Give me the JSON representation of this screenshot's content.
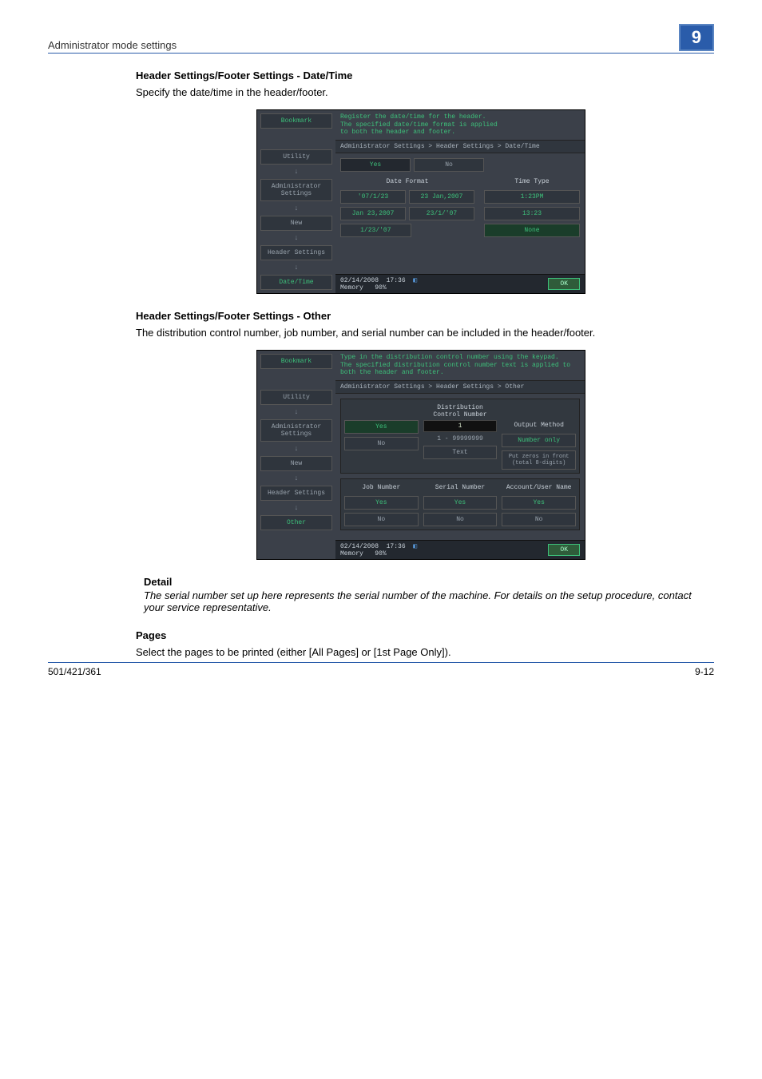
{
  "header": {
    "title": "Administrator mode settings",
    "chapter": "9"
  },
  "sections": {
    "datetime": {
      "title": "Header Settings/Footer Settings - Date/Time",
      "body": "Specify the date/time in the header/footer."
    },
    "other": {
      "title": "Header Settings/Footer Settings - Other",
      "body": "The distribution control number, job number, and serial number can be included in the header/footer."
    },
    "pages": {
      "title": "Pages",
      "body": "Select the pages to be printed (either [All Pages] or [1st Page Only])."
    }
  },
  "detail": {
    "label": "Detail",
    "body": "The serial number set up here represents the serial number of the machine. For details on the setup procedure, contact your service representative."
  },
  "footer": {
    "left": "501/421/361",
    "right": "9-12"
  },
  "ss1": {
    "instr": "Register the date/time for the header.\nThe specified date/time format is applied\nto both the header and footer.",
    "breadcrumb": "Administrator Settings > Header Settings > Date/Time",
    "yes": "Yes",
    "no": "No",
    "col1": "Date Format",
    "col2": "Time Type",
    "date_opts": [
      "'07/1/23",
      "23 Jan,2007",
      "Jan 23,2007",
      "23/1/'07",
      "1/23/'07"
    ],
    "time_opts": [
      "1:23PM",
      "13:23",
      "None"
    ],
    "side": {
      "bookmark": "Bookmark",
      "utility": "Utility",
      "admin": "Administrator\nSettings",
      "new": "New",
      "header": "Header Settings",
      "datetime": "Date/Time"
    },
    "status": {
      "date": "02/14/2008",
      "time": "17:36",
      "mem": "Memory",
      "pct": "90%",
      "ok": "OK"
    }
  },
  "ss2": {
    "instr": "Type in the distribution control number using the keypad.\nThe specified distribution control number text is applied to\nboth the header and footer.",
    "breadcrumb": "Administrator Settings > Header Settings > Other",
    "dcn_label": "Distribution\nControl Number",
    "yes": "Yes",
    "no": "No",
    "num_current": "1",
    "num_range": "1  -  99999999",
    "text_btn": "Text",
    "out_header": "Output Method",
    "out_opt1": "Number only",
    "out_opt2": "Put zeros in front\n(total 8-digits)",
    "col_job": "Job Number",
    "col_serial": "Serial Number",
    "col_acct": "Account/User Name",
    "side": {
      "bookmark": "Bookmark",
      "utility": "Utility",
      "admin": "Administrator\nSettings",
      "new": "New",
      "header": "Header Settings",
      "other": "Other"
    },
    "status": {
      "date": "02/14/2008",
      "time": "17:36",
      "mem": "Memory",
      "pct": "90%",
      "ok": "OK"
    }
  }
}
